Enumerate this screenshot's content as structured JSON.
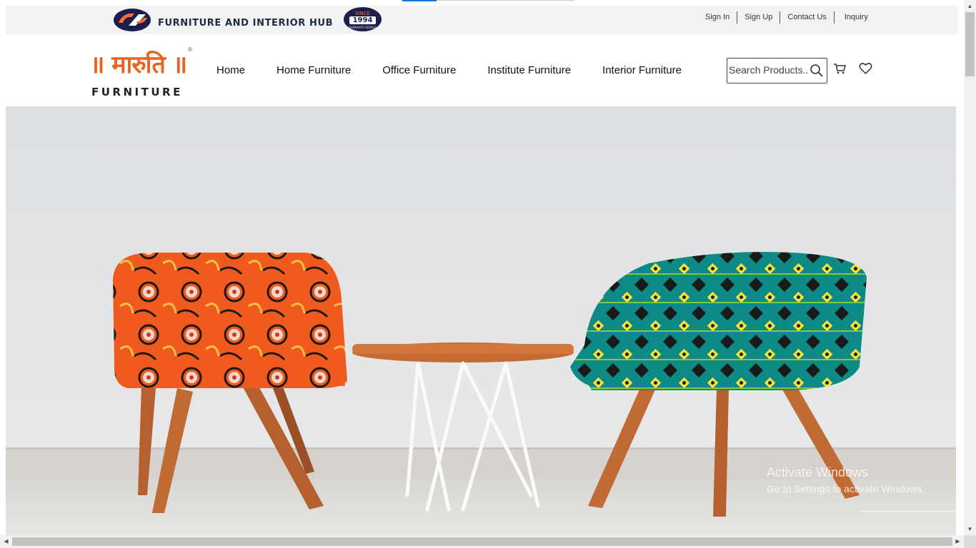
{
  "topbar": {
    "hub_title": "FURNITURE AND INTERIOR HUB",
    "badge": {
      "since": "SINCE",
      "year": "1994",
      "tagline": "KARNAVATI KERALA"
    },
    "links": [
      "Sign In",
      "Sign Up",
      "Contact Us",
      "Inquiry"
    ]
  },
  "brand": {
    "name_devanagari": "॥ मारुति ॥",
    "name_latin": "FURNITURE",
    "registered_mark": "®",
    "accent_color": "#e8641f"
  },
  "nav": {
    "items": [
      "Home",
      "Home Furniture",
      "Office Furniture",
      "Institute Furniture",
      "Interior Furniture"
    ]
  },
  "search": {
    "placeholder": "Search Products..",
    "icon": "search-icon"
  },
  "actions": {
    "cart_icon": "cart-icon",
    "wishlist_icon": "heart-icon"
  },
  "hero": {
    "scene": "two-patterned-armchairs-with-round-table"
  },
  "watermark": {
    "line1": "Activate Windows",
    "line2": "Go to Settings to activate Windows."
  },
  "scrollbars": {
    "up": "▲",
    "down": "▼",
    "left": "◀",
    "right": "▶"
  }
}
